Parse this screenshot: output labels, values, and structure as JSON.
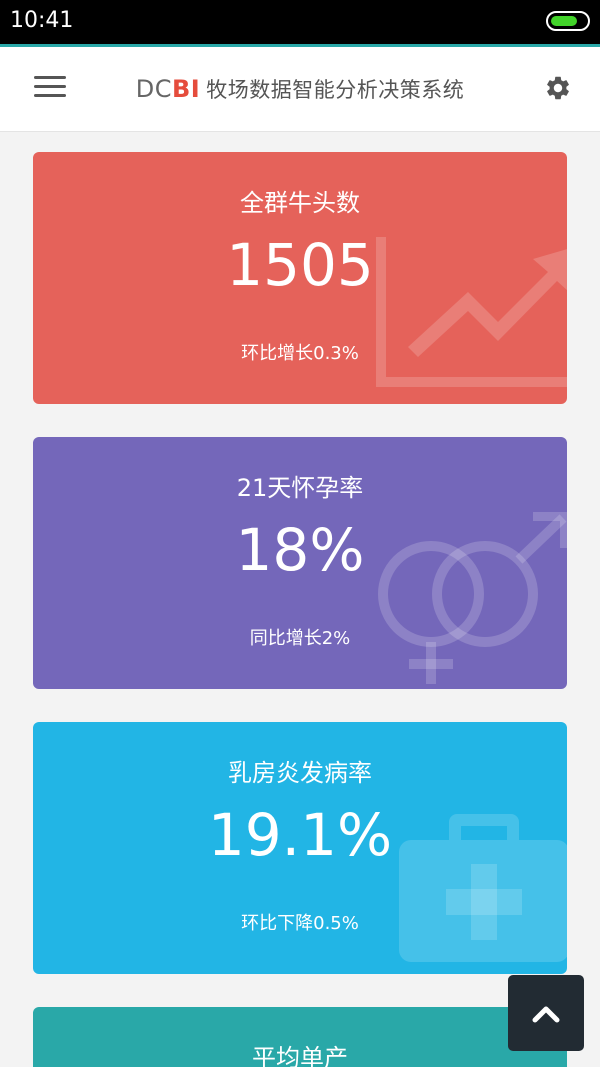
{
  "status_bar": {
    "time": "10:41",
    "battery_level": 0.75
  },
  "header": {
    "brand_dc": "DC",
    "brand_bi": "BI",
    "subtitle": "牧场数据智能分析决策系统",
    "menu_icon": "hamburger-menu-icon",
    "settings_icon": "gear-icon"
  },
  "cards": [
    {
      "title": "全群牛头数",
      "value": "1505",
      "change": "环比增长0.3%",
      "color": "#e5625a",
      "icon": "trend-chart-icon"
    },
    {
      "title": "21天怀孕率",
      "value": "18%",
      "change": "同比增长2%",
      "color": "#7467ba",
      "icon": "gender-icon"
    },
    {
      "title": "乳房炎发病率",
      "value": "19.1%",
      "change": "环比下降0.5%",
      "color": "#22b5e5",
      "icon": "medical-kit-icon"
    },
    {
      "title": "平均单产",
      "color": "#29a8a8"
    }
  ],
  "back_to_top_icon": "chevron-up-icon",
  "colors": {
    "accent_teal": "#29a8a8",
    "brand_red": "#e54c3c",
    "status_bar": "#000000",
    "back_to_top_bg": "#222b33"
  }
}
